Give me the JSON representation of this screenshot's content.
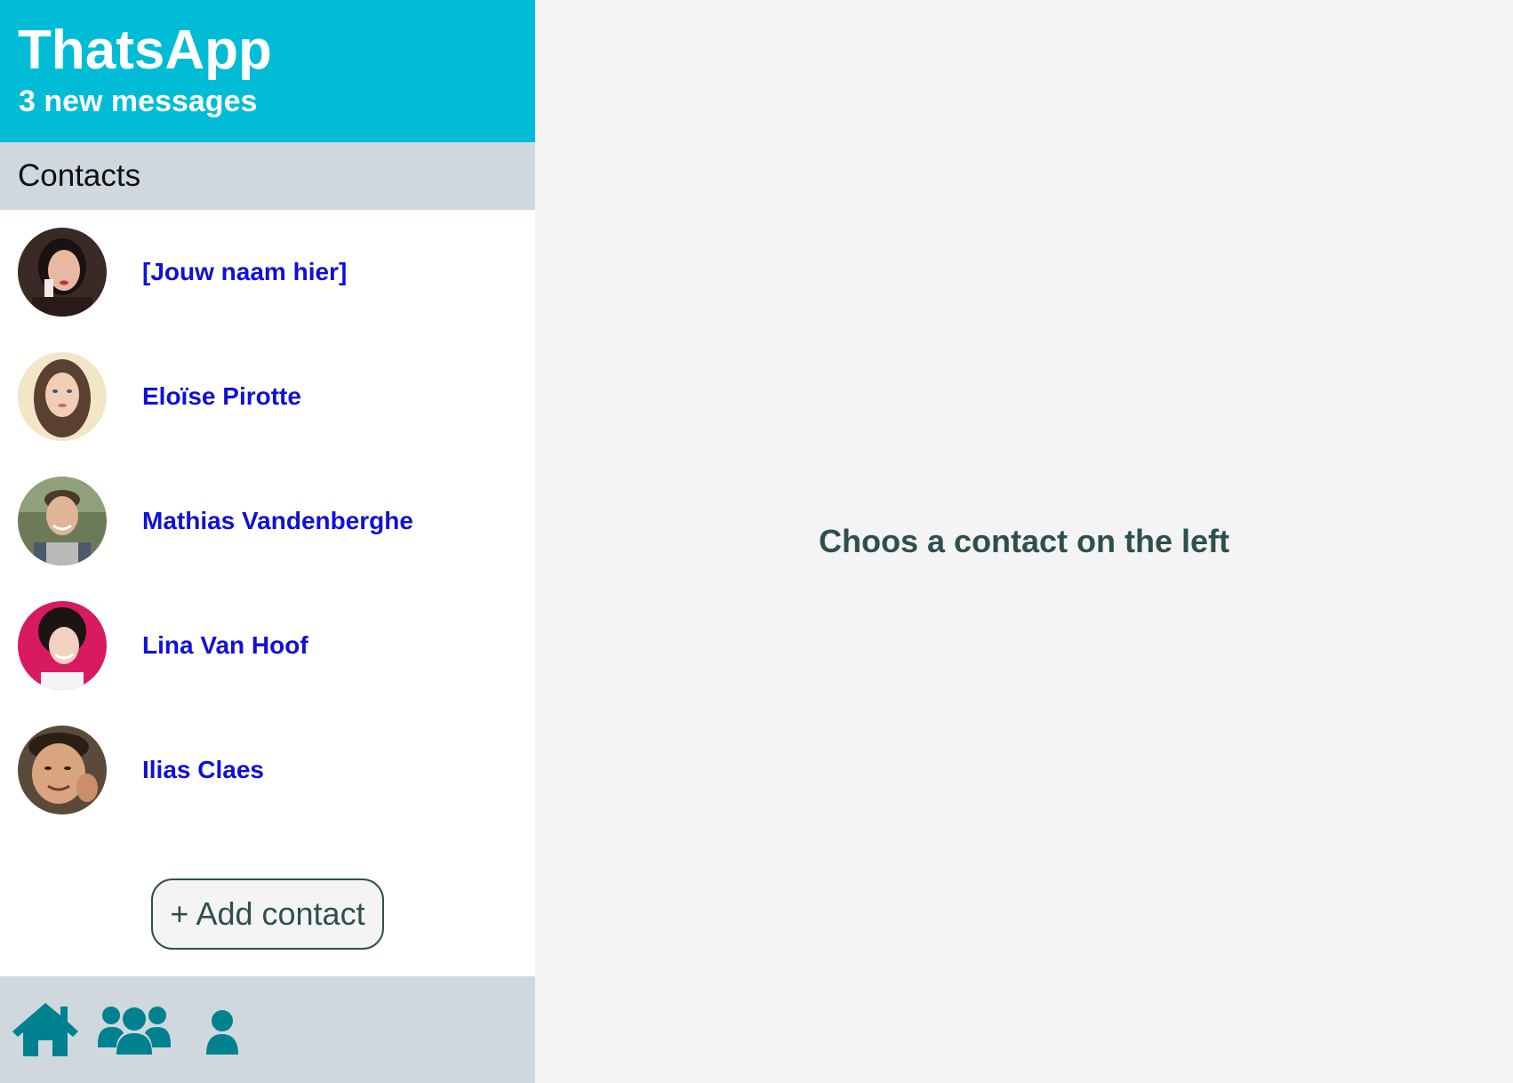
{
  "header": {
    "title": "ThatsApp",
    "subtitle": "3 new messages"
  },
  "contacts": {
    "heading": "Contacts",
    "items": [
      {
        "name": "[Jouw naam hier]",
        "avatar_bg": "#3a2a26",
        "skin": "#e8b9a0",
        "hair": "#1a1210"
      },
      {
        "name": "Eloïse Pirotte",
        "avatar_bg": "#f2e6c6",
        "skin": "#f0cdb5",
        "hair": "#5a4030"
      },
      {
        "name": "Mathias Vandenberghe",
        "avatar_bg": "#6d7a5a",
        "skin": "#e0b496",
        "hair": "#4a3a2a"
      },
      {
        "name": "Lina Van Hoof",
        "avatar_bg": "#d81b60",
        "skin": "#f1d2bf",
        "hair": "#1b1412"
      },
      {
        "name": "Ilias Claes",
        "avatar_bg": "#5a4a3a",
        "skin": "#d9a57e",
        "hair": "#2b1e14"
      }
    ],
    "add_label": "+ Add contact"
  },
  "footer": {
    "icons": [
      "home-icon",
      "group-icon",
      "user-icon"
    ],
    "icon_color": "#00818f"
  },
  "main": {
    "placeholder": "Choos a contact on the left"
  },
  "colors": {
    "header_bg": "#00bcd6",
    "bar_bg": "#cfd8dd",
    "link": "#1010d8",
    "text_dark": "#2f4f4f"
  }
}
